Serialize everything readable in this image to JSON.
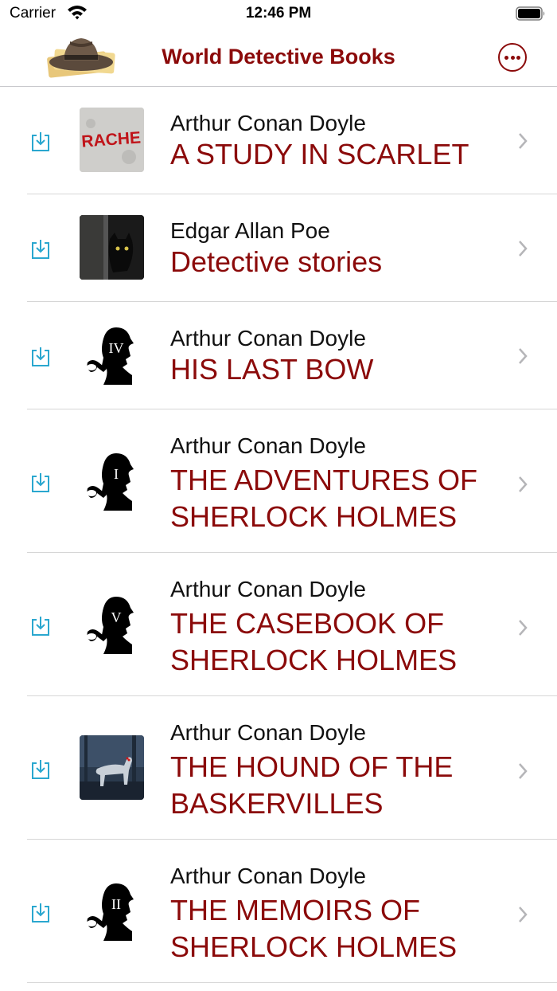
{
  "status_bar": {
    "carrier": "Carrier",
    "time": "12:46 PM"
  },
  "nav": {
    "title": "World Detective Books",
    "logo_icon": "detective-hat-icon",
    "more_icon": "ellipsis-circle-icon"
  },
  "colors": {
    "accent": "#8b0a0a",
    "download": "#2aa7cf",
    "separator": "#d6d6d6"
  },
  "books": [
    {
      "author": "Arthur Conan Doyle",
      "title": "A STUDY IN SCARLET",
      "cover": "rache-cover",
      "cover_text": "RACHE"
    },
    {
      "author": "Edgar Allan Poe",
      "title": "Detective stories",
      "cover": "black-cat-cover"
    },
    {
      "author": "Arthur Conan Doyle",
      "title": "HIS LAST BOW",
      "cover": "sherlock-silhouette",
      "numeral": "IV"
    },
    {
      "author": "Arthur Conan Doyle",
      "title": "THE ADVENTURES OF SHERLOCK HOLMES",
      "cover": "sherlock-silhouette",
      "numeral": "I"
    },
    {
      "author": "Arthur Conan Doyle",
      "title": "THE CASEBOOK OF SHERLOCK HOLMES",
      "cover": "sherlock-silhouette",
      "numeral": "V"
    },
    {
      "author": "Arthur Conan Doyle",
      "title": "THE HOUND OF THE BASKERVILLES",
      "cover": "hound-cover"
    },
    {
      "author": "Arthur Conan Doyle",
      "title": "THE MEMOIRS OF SHERLOCK HOLMES",
      "cover": "sherlock-silhouette",
      "numeral": "II"
    }
  ]
}
